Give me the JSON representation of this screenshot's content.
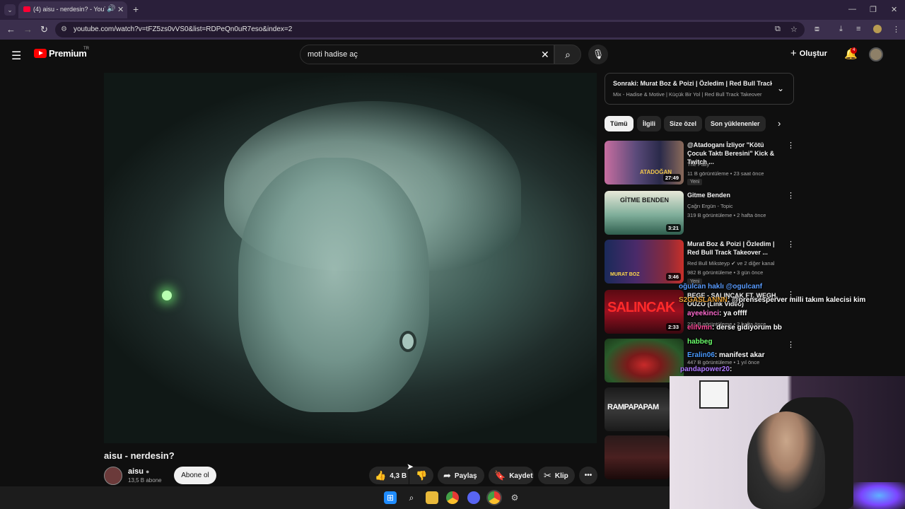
{
  "browser": {
    "tab_title": "(4) aisu - nerdesin? - YouTube",
    "url": "youtube.com/watch?v=tFZ5zs0vVS0&list=RDPeQn0uR7eso&index=2"
  },
  "masthead": {
    "logo_text": "Premium",
    "country": "TR",
    "search_value": "moti hadise aç",
    "create_label": "Oluştur",
    "notif_count": "4"
  },
  "video": {
    "title": "aisu - nerdesin?",
    "channel": "aisu",
    "subscribers": "13,5 B abone",
    "subscribe_label": "Abone ol",
    "likes": "4,3 B",
    "share_label": "Paylaş",
    "save_label": "Kaydet",
    "clip_label": "Klip"
  },
  "up_next": {
    "title": "Sonraki: Murat Boz & Poizi | Özledim | Red Bull Track Takeover",
    "subtitle": "Mix - Hadise & Motive | Küçük Bir Yol | Red Bull Track Takeover"
  },
  "chips": [
    "Tümü",
    "İlgili",
    "Size özel",
    "Son yüklenenler"
  ],
  "recommendations": [
    {
      "title": "@Atadoganı İzliyor \"Kötü Çocuk Taktı Beresini\" Kick & Twitch ...",
      "channel": "The Pally",
      "meta": "11 B görüntüleme • 23 saat önce",
      "badge": "Yeni",
      "duration": "27:49",
      "thumb_text": "ATADOĞAN"
    },
    {
      "title": "Gitme Benden",
      "channel": "Çağrı Ergün - Topic",
      "meta": "319 B görüntüleme • 2 hafta önce",
      "badge": "",
      "duration": "3:21",
      "thumb_text": "GİTME BENDEN"
    },
    {
      "title": "Murat Boz & Poizi | Özledim | Red Bull Track Takeover ...",
      "channel": "Red Bull Miksteyp ✔ ve 2 diğer kanal",
      "meta": "982 B görüntüleme • 3 gün önce",
      "badge": "Yeni",
      "duration": "3:46",
      "thumb_text": "MURAT BOZ"
    },
    {
      "title": "BEGE - SALINCAK FT. WEGH, OUZO (Link Video)",
      "channel": "",
      "meta": "232 B görüntüleme • 2 hafta önce",
      "badge": "",
      "duration": "2:33",
      "thumb_text": "SALINCAK"
    },
    {
      "title": "",
      "channel": "",
      "meta": "447 B görüntüleme • 1 yıl önce",
      "badge": "",
      "duration": "",
      "thumb_text": ""
    },
    {
      "title": "",
      "channel": "",
      "meta": "",
      "badge": "",
      "duration": "",
      "thumb_text": "RAMPAPAPAM"
    },
    {
      "title": "",
      "channel": "",
      "meta": "",
      "badge": "",
      "duration": "",
      "thumb_text": ""
    }
  ],
  "chat": [
    {
      "user": "oğulcan haklı @ogulcanf",
      "msg": ""
    },
    {
      "user": "S2GASLANNN",
      "msg": ": @prensesperver milli takım kalecisi kim"
    },
    {
      "user": "ayeekinci",
      "msg": ": ya offff"
    },
    {
      "user": "elifvmn",
      "msg": ": derse gidiyorum bb"
    },
    {
      "user": "habbeg",
      "msg": ""
    },
    {
      "user": "Eralin06",
      "msg": ": manifest akar"
    },
    {
      "user": "pandapower20",
      "msg": ":"
    }
  ]
}
